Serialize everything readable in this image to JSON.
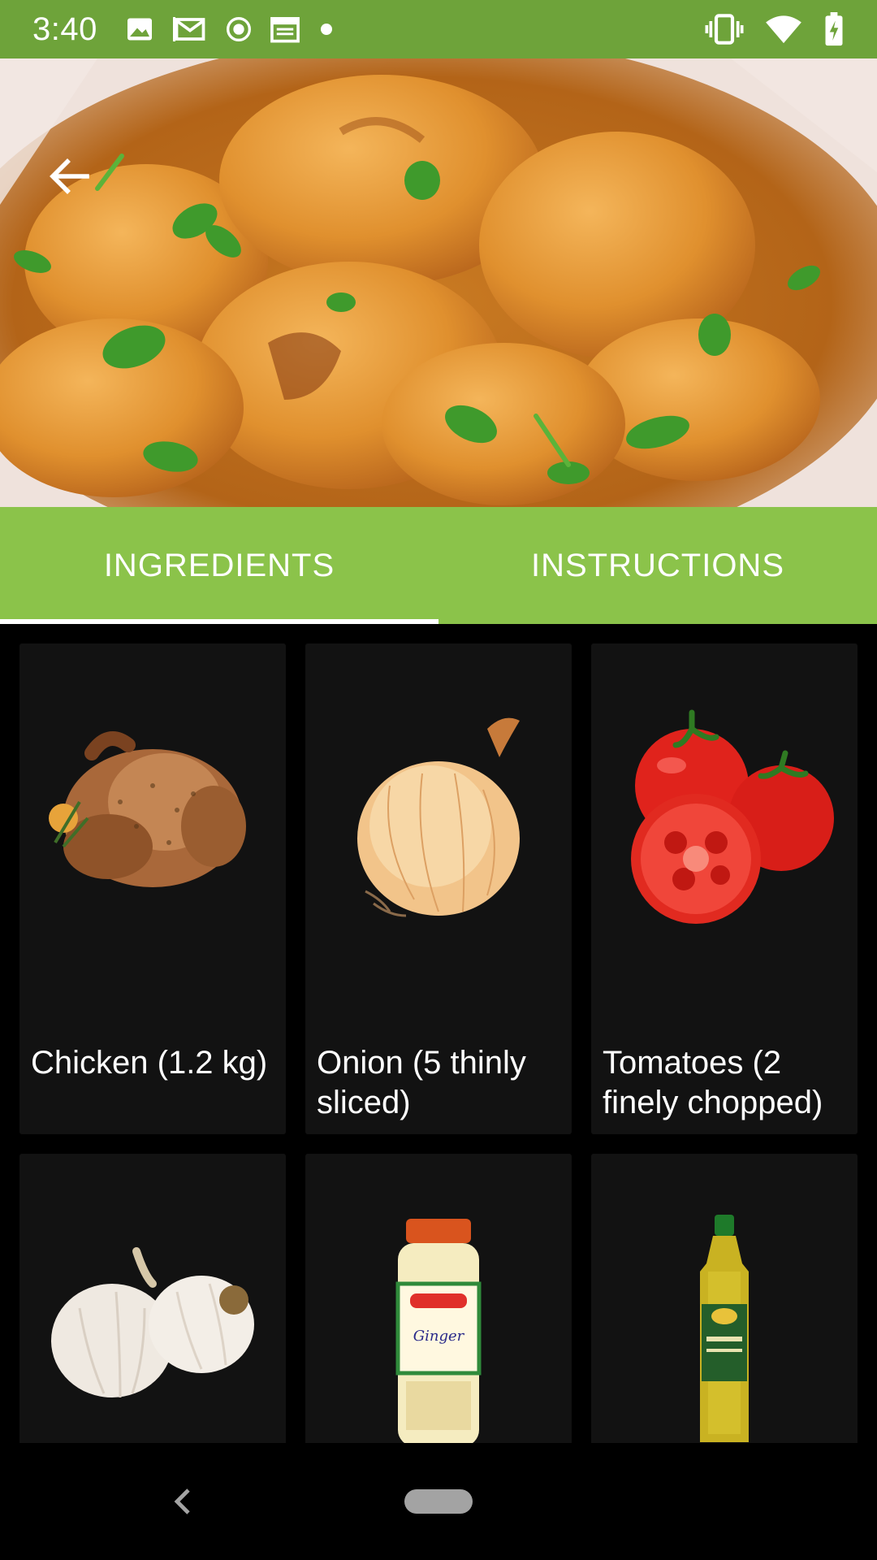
{
  "status_bar": {
    "time": "3:40",
    "left_icons": [
      "image-icon",
      "gmail-icon",
      "record-icon",
      "calendar-icon",
      "dot-icon"
    ],
    "right_icons": [
      "vibrate-icon",
      "wifi-icon",
      "battery-charging-icon"
    ],
    "color": "#6ea33a"
  },
  "hero": {
    "image": "chicken-curry-photo",
    "back_icon": "arrow-back-icon"
  },
  "tabs": [
    {
      "label": "INGREDIENTS",
      "selected": true
    },
    {
      "label": "INSTRUCTIONS",
      "selected": false
    }
  ],
  "tab_color": "#8bc34a",
  "ingredients": [
    {
      "label": "Chicken (1.2 kg)",
      "image": "roast-chicken"
    },
    {
      "label": "Onion (5 thinly sliced)",
      "image": "onion"
    },
    {
      "label": "Tomatoes (2 finely chopped)",
      "image": "tomatoes"
    },
    {
      "label": "",
      "image": "garlic"
    },
    {
      "label": "",
      "image": "ginger-paste-jar"
    },
    {
      "label": "",
      "image": "vegetable-oil-bottle"
    }
  ],
  "nav_bar": {
    "back_icon": "nav-back-icon",
    "home_icon": "nav-home-pill"
  }
}
